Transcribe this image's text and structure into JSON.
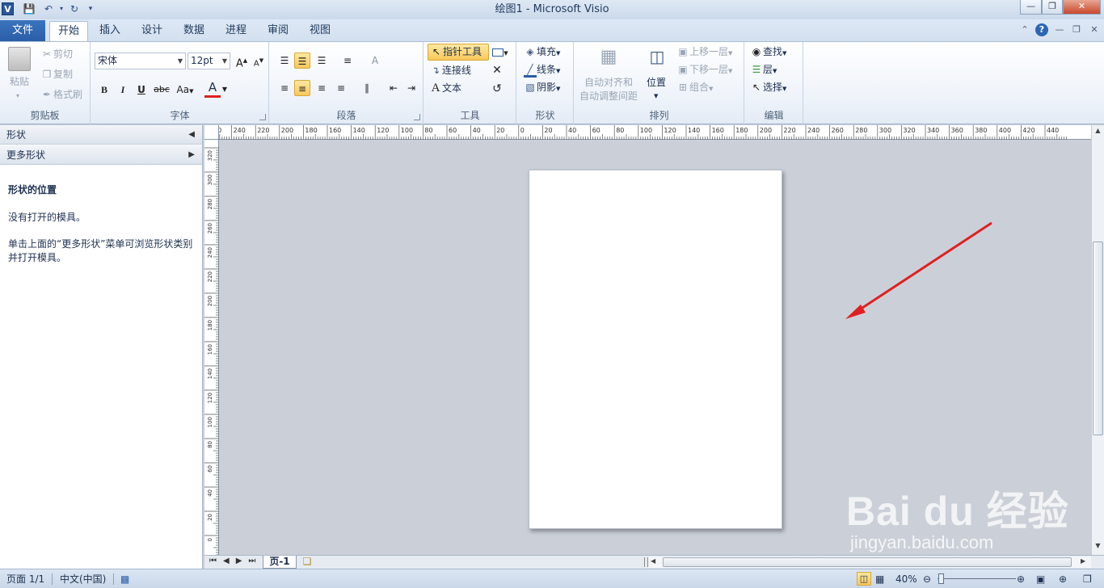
{
  "window": {
    "title": "绘图1  -  Microsoft Visio"
  },
  "tabs": {
    "file": "文件",
    "items": [
      "开始",
      "插入",
      "设计",
      "数据",
      "进程",
      "审阅",
      "视图"
    ],
    "active": "开始"
  },
  "ribbon": {
    "clipboard": {
      "paste": "粘贴",
      "cut": "剪切",
      "copy": "复制",
      "format_painter": "格式刷",
      "label": "剪贴板"
    },
    "font": {
      "name": "宋体",
      "size": "12pt",
      "bold": "B",
      "italic": "I",
      "underline": "U",
      "strike": "abc",
      "case": "Aa",
      "color": "A",
      "grow": "A",
      "shrink": "A",
      "label": "字体"
    },
    "paragraph": {
      "label": "段落"
    },
    "tools": {
      "pointer": "指针工具",
      "connector": "连接线",
      "text": "文本",
      "label": "工具"
    },
    "shape": {
      "fill": "填充",
      "line": "线条",
      "shadow": "阴影",
      "label": "形状"
    },
    "arrange": {
      "auto_align_1": "自动对齐和",
      "auto_align_2": "自动调整间距",
      "position": "位置",
      "bring_forward": "上移一层",
      "send_backward": "下移一层",
      "group": "组合",
      "label": "排列"
    },
    "editing": {
      "find": "查找",
      "layers": "层",
      "select": "选择",
      "label": "编辑"
    }
  },
  "panel": {
    "header": "形状",
    "more_shapes": "更多形状",
    "section_title": "形状的位置",
    "line1": "没有打开的模具。",
    "line2": "单击上面的“更多形状”菜单可浏览形状类别并打开模具。"
  },
  "rulers": {
    "h_ticks": [
      "250",
      "240",
      "220",
      "200",
      "180",
      "160",
      "140",
      "120",
      "100",
      "80",
      "60",
      "40",
      "20",
      "0",
      "20",
      "40",
      "60",
      "80",
      "100",
      "120",
      "140",
      "160",
      "180",
      "200",
      "220",
      "240",
      "260",
      "280",
      "300",
      "320",
      "340",
      "360",
      "380",
      "400",
      "420",
      "440"
    ],
    "v_ticks": [
      "320",
      "300",
      "280",
      "260",
      "240",
      "220",
      "200",
      "180",
      "160",
      "140",
      "120",
      "100",
      "80",
      "60",
      "40",
      "20",
      "0"
    ]
  },
  "page_tabs": {
    "current": "页-1"
  },
  "status": {
    "page": "页面 1/1",
    "language": "中文(中国)",
    "zoom": "40%"
  },
  "watermark": {
    "brand": "Bai du 经验",
    "url": "jingyan.baidu.com"
  },
  "colors": {
    "accent": "#2a5da7",
    "arrow": "#e02020",
    "canvas": "#cbd0d8"
  }
}
